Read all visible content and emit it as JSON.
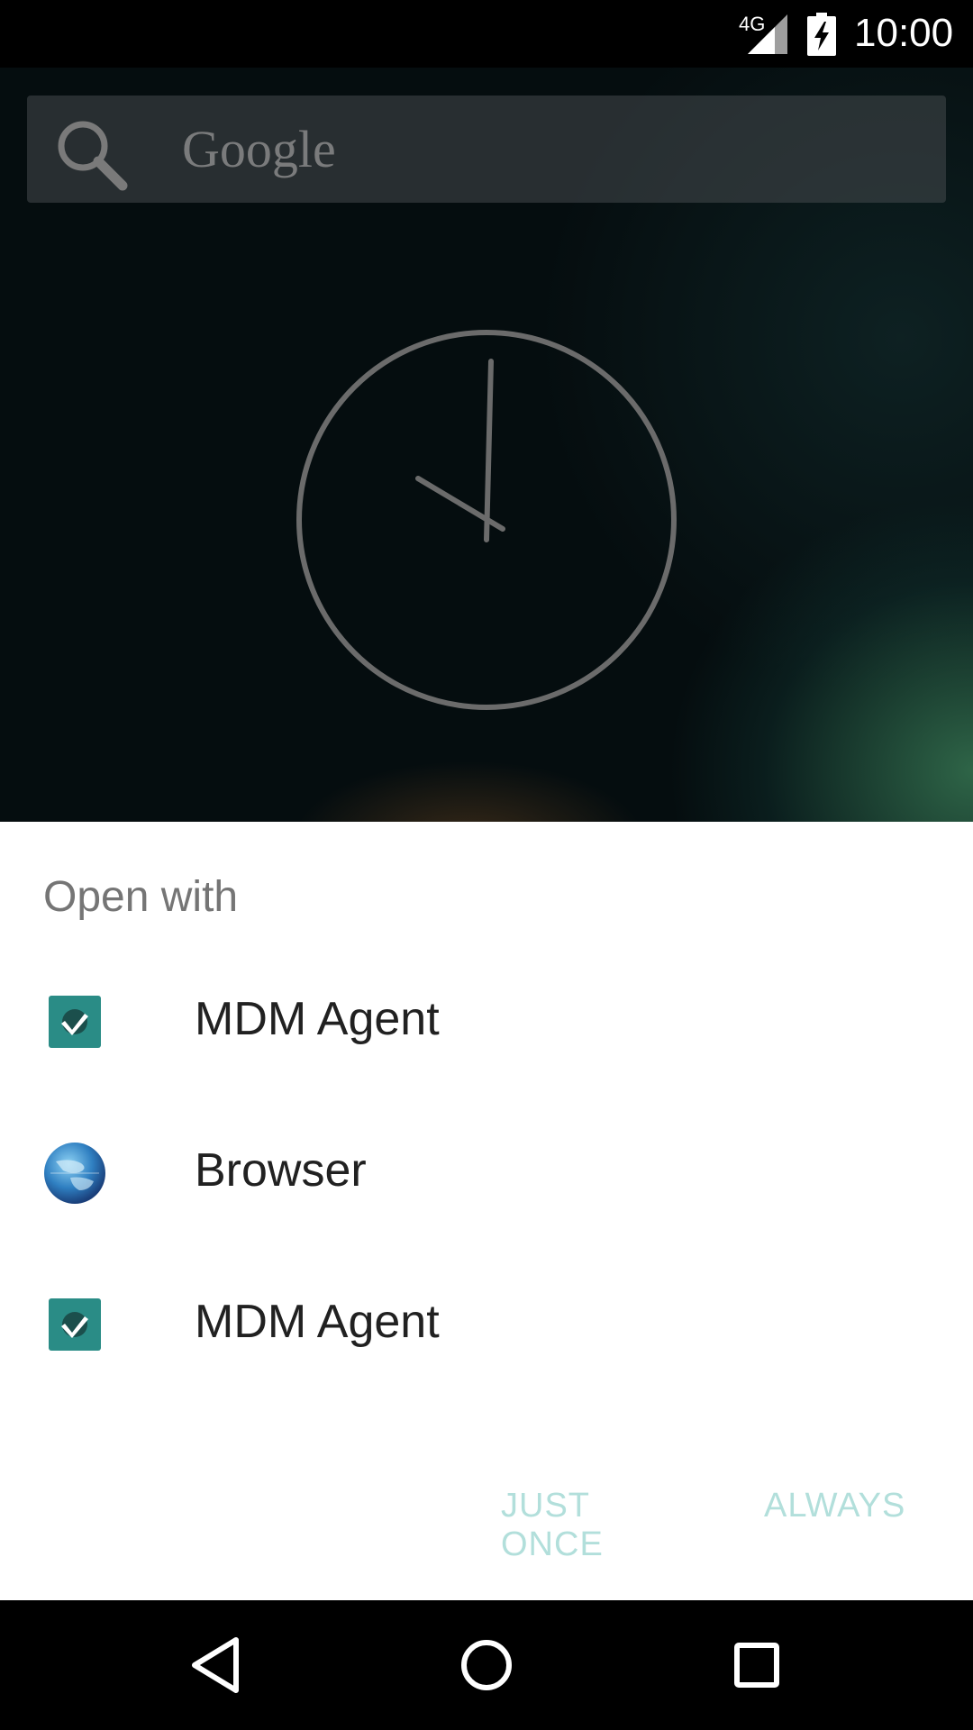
{
  "status_bar": {
    "network": "4G",
    "time": "10:00"
  },
  "home": {
    "search_placeholder": "Google"
  },
  "dialog": {
    "title": "Open with",
    "apps": [
      {
        "label": "MDM Agent",
        "icon": "mdm-agent-icon"
      },
      {
        "label": "Browser",
        "icon": "browser-globe-icon"
      },
      {
        "label": "MDM Agent",
        "icon": "mdm-agent-icon"
      }
    ],
    "actions": {
      "just_once": "JUST ONCE",
      "always": "ALWAYS"
    }
  },
  "colors": {
    "accent_disabled": "#b2dfdb",
    "mdm_icon": "#2a8c86",
    "title_text": "#757575",
    "item_text": "#212121"
  }
}
